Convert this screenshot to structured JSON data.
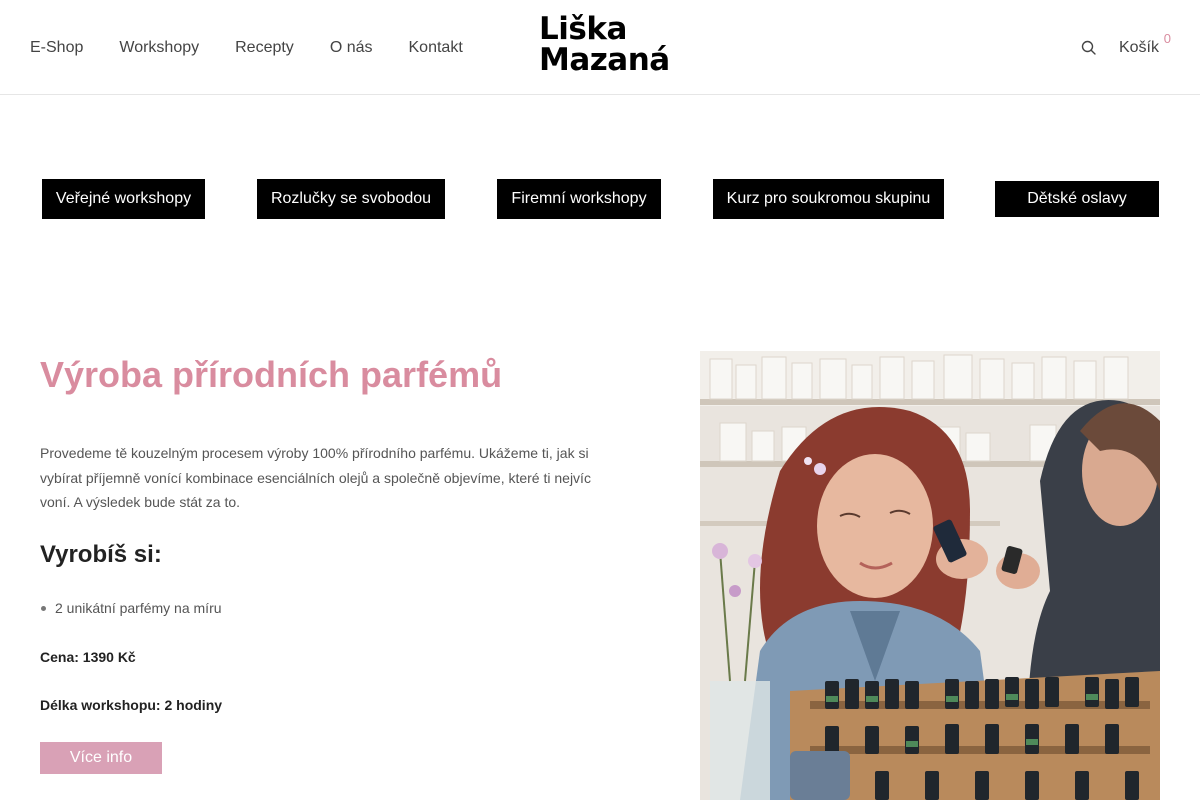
{
  "header": {
    "nav": [
      "E-Shop",
      "Workshopy",
      "Recepty",
      "O nás",
      "Kontakt"
    ],
    "logo_line1": "Liška",
    "logo_line2": "Mazaná",
    "cart_label": "Košík",
    "cart_count": "0",
    "search_icon": "search-icon"
  },
  "categories": [
    "Veřejné workshopy",
    "Rozlučky se svobodou",
    "Firemní workshopy",
    "Kurz pro soukromou skupinu",
    "Dětské oslavy"
  ],
  "workshop": {
    "title": "Výroba přírodních parfémů",
    "description": "Provedeme tě kouzelným procesem výroby 100% přírodního parfému. Ukážeme ti, jak si vybírat příjemně vonící kombinace esenciálních olejů a společně objevíme, které ti nejvíc voní. A výsledek bude stát za to.",
    "subheading": "Vyrobíš si:",
    "items": [
      "2 unikátní parfémy na míru"
    ],
    "price": "Cena: 1390 Kč",
    "duration": "Délka workshopu: 2 hodiny",
    "more_button": "Více info"
  },
  "colors": {
    "accent": "#d98c9f",
    "button_pink": "#d9a1b6",
    "category_bg": "#000000"
  }
}
